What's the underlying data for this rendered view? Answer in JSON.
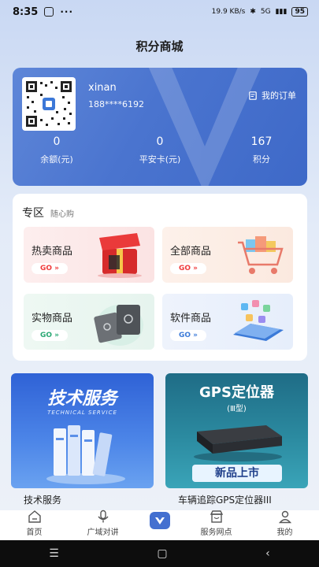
{
  "status_bar": {
    "time": "8:35",
    "dots": "···",
    "network_speed": "19.9 KB/s",
    "signal": "5G",
    "battery": "95"
  },
  "page": {
    "title": "积分商城"
  },
  "account": {
    "username": "xinan",
    "phone": "188****6192",
    "orders_label": "我的订单",
    "stats": [
      {
        "value": "0",
        "label": "余额(元)"
      },
      {
        "value": "0",
        "label": "平安卡(元)"
      },
      {
        "value": "167",
        "label": "积分"
      }
    ]
  },
  "zone": {
    "title": "专区",
    "subtitle": "随心购",
    "tiles": [
      {
        "label": "热卖商品",
        "go": "GO »",
        "color": "#f03a3a"
      },
      {
        "label": "全部商品",
        "go": "GO »",
        "color": "#f03a3a"
      },
      {
        "label": "实物商品",
        "go": "GO »",
        "color": "#2aa874"
      },
      {
        "label": "软件商品",
        "go": "GO »",
        "color": "#3b7ad8"
      }
    ]
  },
  "promos": [
    {
      "banner_title": "技术服务",
      "banner_sub": "TECHNICAL SERVICE",
      "caption": "技术服务"
    },
    {
      "banner_title": "GPS定位器",
      "banner_sub": "(Ⅲ型)",
      "banner_tag": "新品上市",
      "caption": "车辆追踪GPS定位器III"
    }
  ],
  "nav": {
    "items": [
      {
        "label": "首页",
        "icon": "home-icon"
      },
      {
        "label": "广域对讲",
        "icon": "microphone-icon"
      },
      {
        "label": "服务网点",
        "icon": "store-icon"
      },
      {
        "label": "我的",
        "icon": "user-icon"
      }
    ]
  },
  "system_nav": {
    "menu": "☰",
    "home": "▢",
    "back": "‹"
  },
  "colors": {
    "accent": "#4470d0",
    "go_red": "#f03a3a",
    "go_green": "#2aa874",
    "go_blue": "#3b7ad8"
  }
}
